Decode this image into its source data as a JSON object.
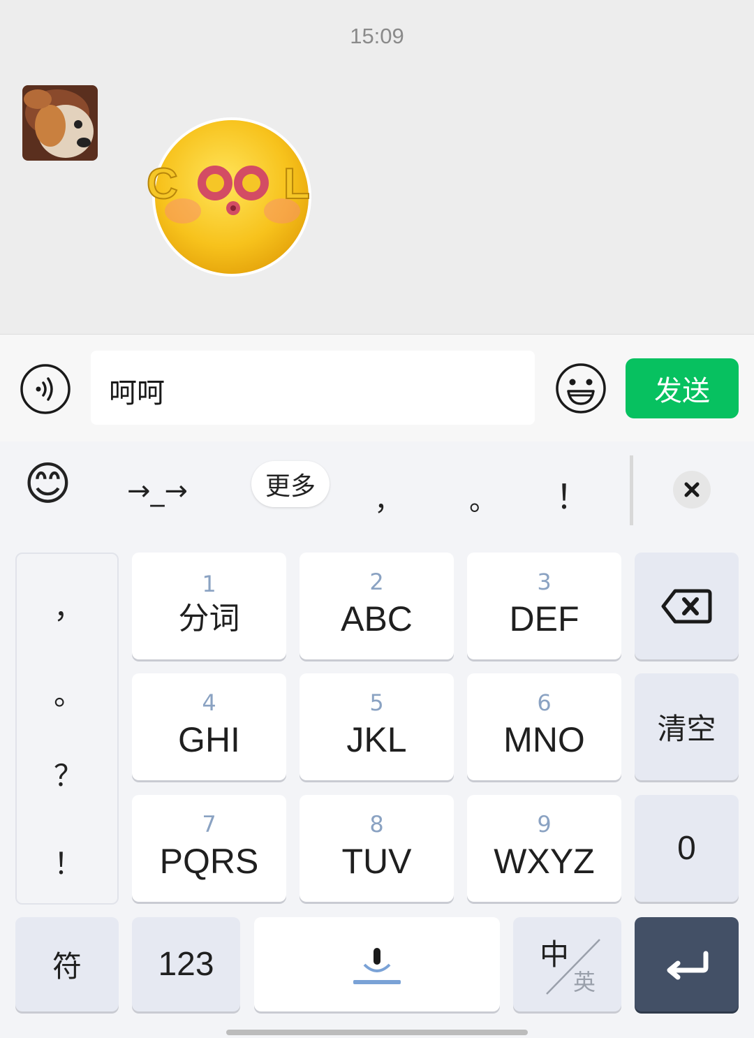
{
  "chat": {
    "timestamp": "15:09"
  },
  "input_bar": {
    "message_text": "呵呵",
    "send_label": "发送",
    "accent": "#07c160"
  },
  "candidates": {
    "emoji": "😊",
    "emoticon": "→_→",
    "more_label": "更多",
    "comma": "，",
    "period": "。",
    "exclaim": "！"
  },
  "keyboard": {
    "punct_column": [
      "，",
      "。",
      "？",
      "！"
    ],
    "keys": [
      {
        "num": "1",
        "letters": "分词"
      },
      {
        "num": "2",
        "letters": "ABC"
      },
      {
        "num": "3",
        "letters": "DEF"
      },
      {
        "num": "4",
        "letters": "GHI"
      },
      {
        "num": "5",
        "letters": "JKL"
      },
      {
        "num": "6",
        "letters": "MNO"
      },
      {
        "num": "7",
        "letters": "PQRS"
      },
      {
        "num": "8",
        "letters": "TUV"
      },
      {
        "num": "9",
        "letters": "WXYZ"
      }
    ],
    "clear_label": "清空",
    "zero_label": "0",
    "symbol_label": "符",
    "num_label": "123",
    "lang_zh": "中",
    "lang_en": "英"
  }
}
